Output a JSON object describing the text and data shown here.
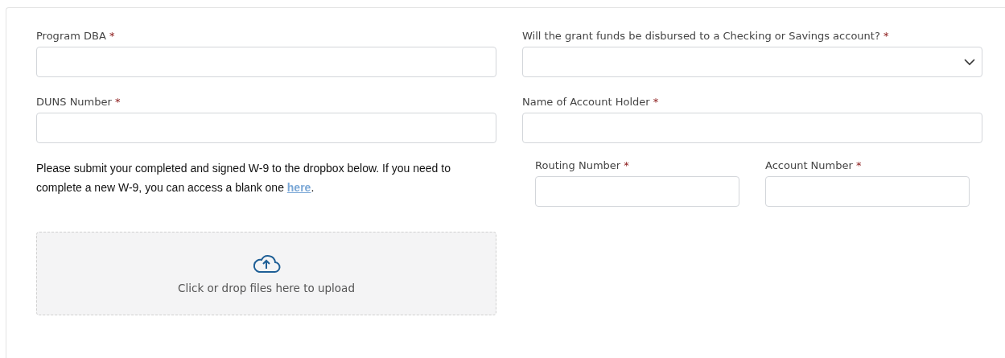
{
  "left_fields": [
    {
      "label": "Program DBA",
      "required_mark": "*",
      "kind": "text"
    },
    {
      "label": "DUNS Number",
      "required_mark": "*",
      "kind": "text"
    }
  ],
  "w9_note": {
    "text": "Please submit your completed and signed W-9 to the dropbox below. If you need to complete a new W-9, you can access a blank one ",
    "link": "here",
    "after": "."
  },
  "upload": {
    "text": "Click or drop files here to upload"
  },
  "right_fields": [
    {
      "label": "Will the grant funds be disbursed to a Checking or Savings account?",
      "required_mark": "*",
      "kind": "select"
    },
    {
      "label": "Name of Account Holder",
      "required_mark": "*",
      "kind": "text"
    }
  ],
  "bank_fields": [
    {
      "label": "Routing Number",
      "required_mark": "*",
      "kind": "text"
    },
    {
      "label": "Account Number",
      "required_mark": "*",
      "kind": "text"
    }
  ]
}
